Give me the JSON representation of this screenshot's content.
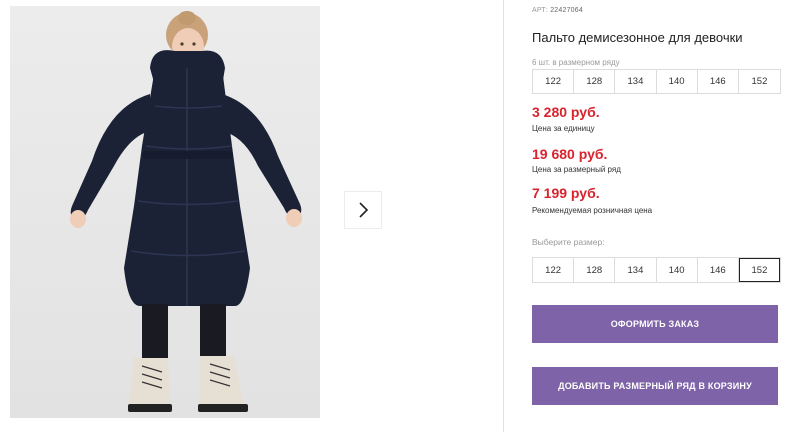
{
  "product": {
    "art_label": "АРТ:",
    "art_number": "22427064",
    "title": "Пальто демисезонное для девочки",
    "pack_note": "6 шт. в размерном ряду"
  },
  "pack_sizes": [
    "122",
    "128",
    "134",
    "140",
    "146",
    "152"
  ],
  "prices": {
    "unit_price": "3 280 руб.",
    "unit_label": "Цена за единицу",
    "row_price": "19 680 руб.",
    "row_label": "Цена за размерный ряд",
    "retail_price": "7 199 руб.",
    "retail_label": "Рекомендуемая розничная цена"
  },
  "size_selector": {
    "label": "Выберите размер:",
    "options": [
      "122",
      "128",
      "134",
      "140",
      "146",
      "152"
    ],
    "selected": "152"
  },
  "buttons": {
    "order": "Оформить заказ",
    "add_row": "Добавить размерный ряд в корзину"
  },
  "gallery": {
    "next_icon": "chevron-right-icon"
  },
  "colors": {
    "price_red": "#d9232d",
    "button_purple": "#7e63a8",
    "coat_navy": "#1b2236"
  }
}
